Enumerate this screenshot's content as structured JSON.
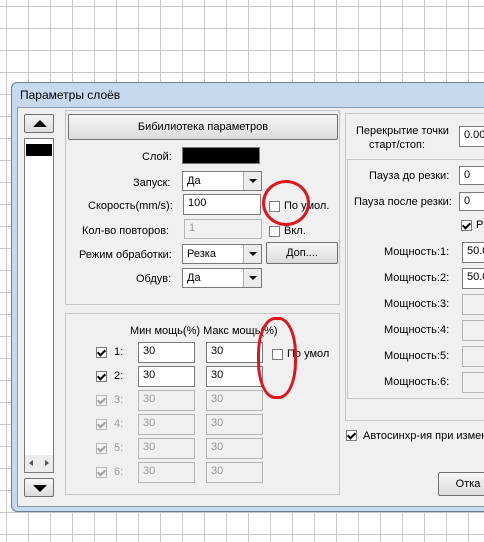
{
  "dialog": {
    "title": "Параметры слоёв"
  },
  "library_button": "Бибилиотека параметров",
  "layer": {
    "label": "Слой:",
    "color": "#000000"
  },
  "launch": {
    "label": "Запуск:",
    "value": "Да"
  },
  "speed": {
    "label": "Скорость(mm/s):",
    "value": "100",
    "default_label": "По умол."
  },
  "repeat": {
    "label": "Кол-во повторов:",
    "value": "1",
    "enable_label": "Вкл."
  },
  "mode": {
    "label": "Режим обработки:",
    "value": "Резка",
    "more_button": "Доп...."
  },
  "blow": {
    "label": "Обдув:",
    "value": "Да"
  },
  "power_table": {
    "header": "Мин мощь(%) Макс мощь(%)",
    "default_label": "По умол",
    "rows": [
      {
        "label": "1:",
        "min": "30",
        "max": "30",
        "checked": true,
        "enabled": true
      },
      {
        "label": "2:",
        "min": "30",
        "max": "30",
        "checked": true,
        "enabled": true
      },
      {
        "label": "3:",
        "min": "30",
        "max": "30",
        "checked": true,
        "enabled": false
      },
      {
        "label": "4:",
        "min": "30",
        "max": "30",
        "checked": true,
        "enabled": false
      },
      {
        "label": "5:",
        "min": "30",
        "max": "30",
        "checked": true,
        "enabled": false
      },
      {
        "label": "6:",
        "min": "30",
        "max": "30",
        "checked": true,
        "enabled": false
      }
    ]
  },
  "right": {
    "overlap_label_1": "Перекрытие точки",
    "overlap_label_2": "старт/стоп:",
    "overlap_value": "0.00",
    "pause_before_label": "Пауза до резки:",
    "pause_before_value": "0",
    "pause_after_label": "Пауза после резки:",
    "pause_after_value": "0",
    "partial_check_label": "Р",
    "powers": [
      {
        "label": "Мощность:1:",
        "value": "50.0"
      },
      {
        "label": "Мощность:2:",
        "value": "50.0"
      },
      {
        "label": "Мощность:3:",
        "value": ""
      },
      {
        "label": "Мощность:4:",
        "value": ""
      },
      {
        "label": "Мощность:5:",
        "value": ""
      },
      {
        "label": "Мощность:6:",
        "value": ""
      }
    ],
    "autosync_label": "Автосинхр-ия при измен",
    "cancel_button": "Отка"
  },
  "colors": {
    "annotation": "#e0141c",
    "selected_item": "#000000"
  }
}
